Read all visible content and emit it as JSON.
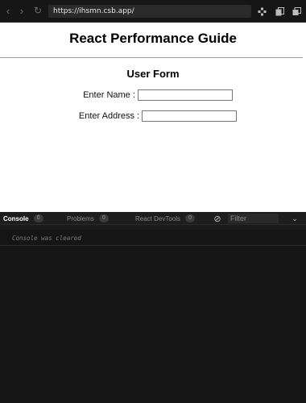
{
  "browser": {
    "url": "https://ihsmn.csb.app/",
    "nav_back_icon": "‹",
    "nav_forward_icon": "›",
    "refresh_icon": "↻",
    "tools": [
      "devtools-icon",
      "new-window-icon",
      "split-view-icon"
    ]
  },
  "preview": {
    "app_title": "React Performance Guide",
    "form_title": "User Form",
    "fields": [
      {
        "label": "Enter Name :",
        "value": ""
      },
      {
        "label": "Enter Address :",
        "value": ""
      }
    ]
  },
  "console": {
    "tabs": [
      {
        "label": "Console",
        "count": "0",
        "active": true
      },
      {
        "label": "Problems",
        "count": "0",
        "active": false
      },
      {
        "label": "React DevTools",
        "count": "0",
        "active": false
      }
    ],
    "filter_placeholder": "Filter",
    "message": "Console was cleared"
  },
  "colors": {
    "topbar_bg": "#161616",
    "console_bg": "#151515",
    "preview_bg": "#ffffff"
  }
}
